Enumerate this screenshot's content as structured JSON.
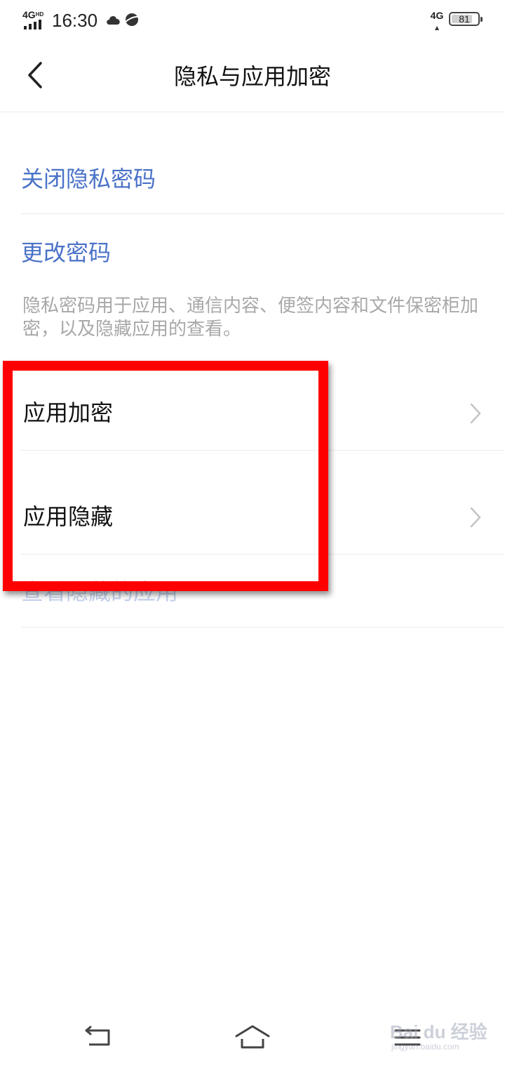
{
  "status_bar": {
    "network_left": "4G",
    "network_left_sup": "HD",
    "time": "16:30",
    "network_right": "4G",
    "battery_percent": "81",
    "battery_level": 0.81,
    "icons": [
      "cloud-icon",
      "planet-icon"
    ]
  },
  "header": {
    "title": "隐私与应用加密",
    "back_icon": "chevron-left-icon"
  },
  "links": {
    "close_password": "关闭隐私密码",
    "change_password": "更改密码"
  },
  "description": "隐私密码用于应用、通信内容、便签内容和文件保密柜加密，以及隐藏应用的查看。",
  "rows": [
    {
      "label": "应用加密",
      "icon": "chevron-right-icon"
    },
    {
      "label": "应用隐藏",
      "icon": "chevron-right-icon"
    }
  ],
  "view_hidden_apps": "查看隐藏的应用",
  "navigation": {
    "icons": [
      "back-nav-icon",
      "home-nav-icon",
      "menu-nav-icon"
    ]
  },
  "watermark": {
    "logo": "Bai du 经验",
    "url": "jingyan.baidu.com"
  },
  "colors": {
    "link": "#4a72c8",
    "description": "#a8a8a8",
    "highlight": "#ff0000",
    "faded_link": "#c5d2ee"
  }
}
